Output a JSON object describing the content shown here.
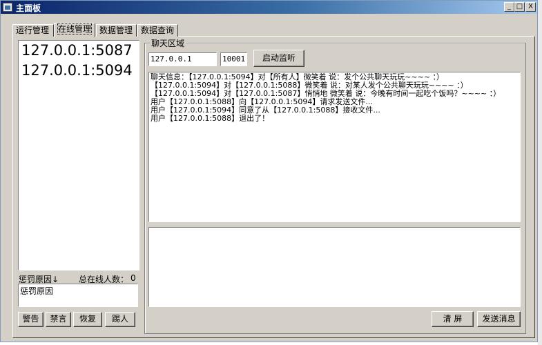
{
  "window": {
    "title": "主面板",
    "minimize_glyph": "_",
    "maximize_glyph": "□",
    "close_glyph": "X"
  },
  "tabs": [
    {
      "label": "运行管理"
    },
    {
      "label": "在线管理"
    },
    {
      "label": "数据管理"
    },
    {
      "label": "数据查询"
    }
  ],
  "online_users": [
    "127.0.0.1:5087",
    "127.0.0.1:5094"
  ],
  "punish": {
    "reason_label": "惩罚原因↓",
    "total_label": "总在线人数：",
    "total_count": "0",
    "reason_value": "惩罚原因",
    "buttons": [
      "警告",
      "禁言",
      "恢复",
      "踢人"
    ]
  },
  "chat": {
    "group_title": "聊天区域",
    "ip_value": "127.0.0.1",
    "port_value": "10001",
    "listen_button": "启动监听",
    "lines": [
      "聊天信息：【127.0.0.1:5094】对【所有人】微笑着 说：发个公共聊天玩玩~~~~ ：）",
      "【127.0.0.1:5094】对【127.0.0.1:5088】微笑着 说：对某人发个公共聊天玩玩~~~~ ：）",
      "【127.0.0.1:5094】对【127.0.0.1:5087】悄悄地 微笑着 说：今晚有时间一起吃个饭吗？~~~~ ：）",
      "用户【127.0.0.1:5088】向【127.0.0.1:5094】请求发送文件...",
      "用户【127.0.0.1:5094】同意了从【127.0.0.1:5088】接收文件...",
      "用户【127.0.0.1:5088】退出了！"
    ],
    "input_value": "",
    "clear_button": "清 屏",
    "send_button": "发送消息"
  }
}
